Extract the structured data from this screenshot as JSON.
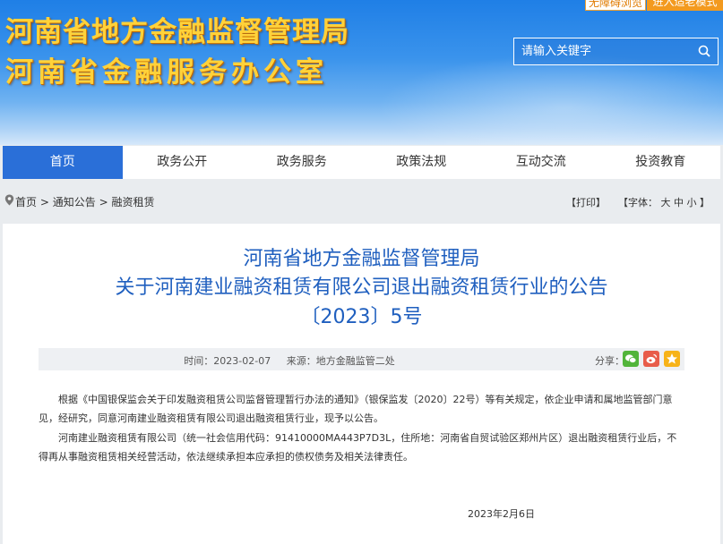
{
  "header": {
    "title_line1": "河南省地方金融监督管理局",
    "title_line2": "河南省金融服务办公室",
    "top_buttons": [
      "无障碍浏览",
      "进入适老模式"
    ],
    "search_placeholder": "请输入关键字"
  },
  "nav": {
    "items": [
      "首页",
      "政务公开",
      "政务服务",
      "政策法规",
      "互动交流",
      "投资教育"
    ],
    "active": "首页"
  },
  "breadcrumb": {
    "items": [
      "首页",
      "通知公告",
      "融资租赁"
    ],
    "separator": ">",
    "print_label": "【打印】",
    "font_label": "【字体：",
    "font_large": "大",
    "font_medium": "中",
    "font_small": "小",
    "font_close": "】"
  },
  "article": {
    "title_line1": "河南省地方金融监督管理局",
    "title_line2": "关于河南建业融资租赁有限公司退出融资租赁行业的公告",
    "title_line3": "〔2023〕5号",
    "time_label": "时间：",
    "time": "2023-02-07",
    "source_label": "来源：",
    "source": "地方金融监管二处",
    "share_label": "分享：",
    "paragraph1": "根据《中国银保监会关于印发融资租赁公司监督管理暂行办法的通知》（银保监发〔2020〕22号）等有关规定，依企业申请和属地监管部门意见，经研究，同意河南建业融资租赁有限公司退出融资租赁行业，现予以公告。",
    "paragraph2": "河南建业融资租赁有限公司（统一社会信用代码：91410000MA443P7D3L，住所地：河南省自贸试验区郑州片区）退出融资租赁行业后，不得再从事融资租赁相关经营活动，依法继续承担本应承担的债权债务及相关法律责任。",
    "date": "2023年2月6日"
  },
  "colors": {
    "accent": "#2a6fd8",
    "title_blue": "#1f5fbf",
    "banner_text": "#ffd23a",
    "orange": "#f39a1f"
  }
}
